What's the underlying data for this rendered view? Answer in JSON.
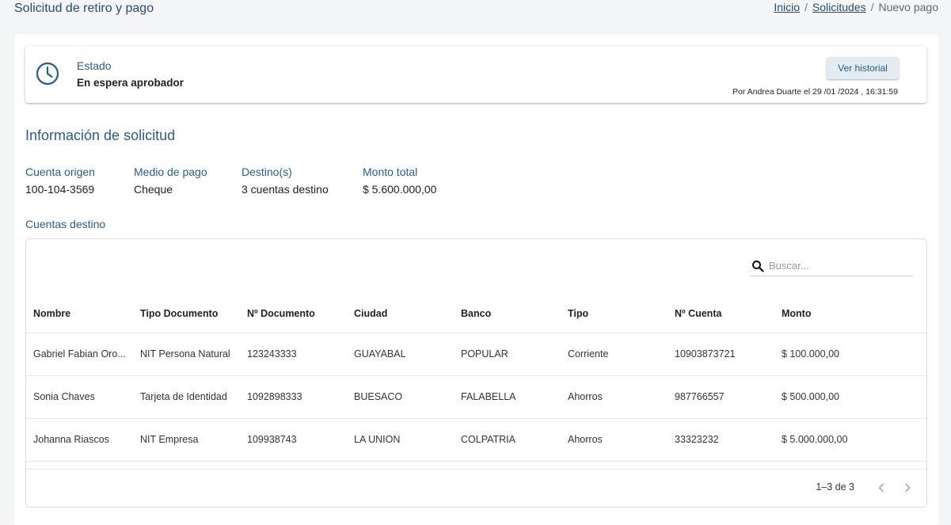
{
  "header": {
    "title": "Solicitud de retiro y pago",
    "breadcrumb": {
      "home": "Inicio",
      "sep1": "/",
      "requests": "Solicitudes",
      "sep2": "/",
      "current": "Nuevo pago"
    }
  },
  "status": {
    "label": "Estado",
    "value": "En espera aprobador",
    "history_button": "Ver historial",
    "meta": "Por Andrea Duarte el 29 /01 /2024 , 16:31:59",
    "icon": "clock-icon"
  },
  "info": {
    "section_title": "Información de solicitud",
    "fields": [
      {
        "label": "Cuenta origen",
        "value": "100-104-3569"
      },
      {
        "label": "Medio de pago",
        "value": "Cheque"
      },
      {
        "label": "Destino(s)",
        "value": "3 cuentas destino"
      },
      {
        "label": "Monto total",
        "value": "$ 5.600.000,00"
      }
    ]
  },
  "destinations": {
    "label": "Cuentas destino",
    "search_placeholder": "Buscar...",
    "columns": [
      "Nombre",
      "Tipo Documento",
      "Nº Documento",
      "Ciudad",
      "Banco",
      "Tipo",
      "Nº Cuenta",
      "Monto"
    ],
    "rows": [
      [
        "Gabriel Fabian Oro...",
        "NIT Persona Natural",
        "123243333",
        "GUAYABAL",
        "POPULAR",
        "Corriente",
        "10903873721",
        "$ 100.000,00"
      ],
      [
        "Sonia Chaves",
        "Tarjeta de Identidad",
        "1092898333",
        "BUESACO",
        "FALABELLA",
        "Ahorros",
        "987766557",
        "$ 500.000,00"
      ],
      [
        "Johanna Riascos",
        "NIT Empresa",
        "109938743",
        "LA UNION",
        "COLPATRIA",
        "Ahorros",
        "33323232",
        "$ 5.000.000,00"
      ]
    ],
    "pagination": "1–3 de 3"
  },
  "colors": {
    "accent": "#2b5b8a",
    "background": "#f4f5f7",
    "button_bg": "#e3ecf1"
  }
}
